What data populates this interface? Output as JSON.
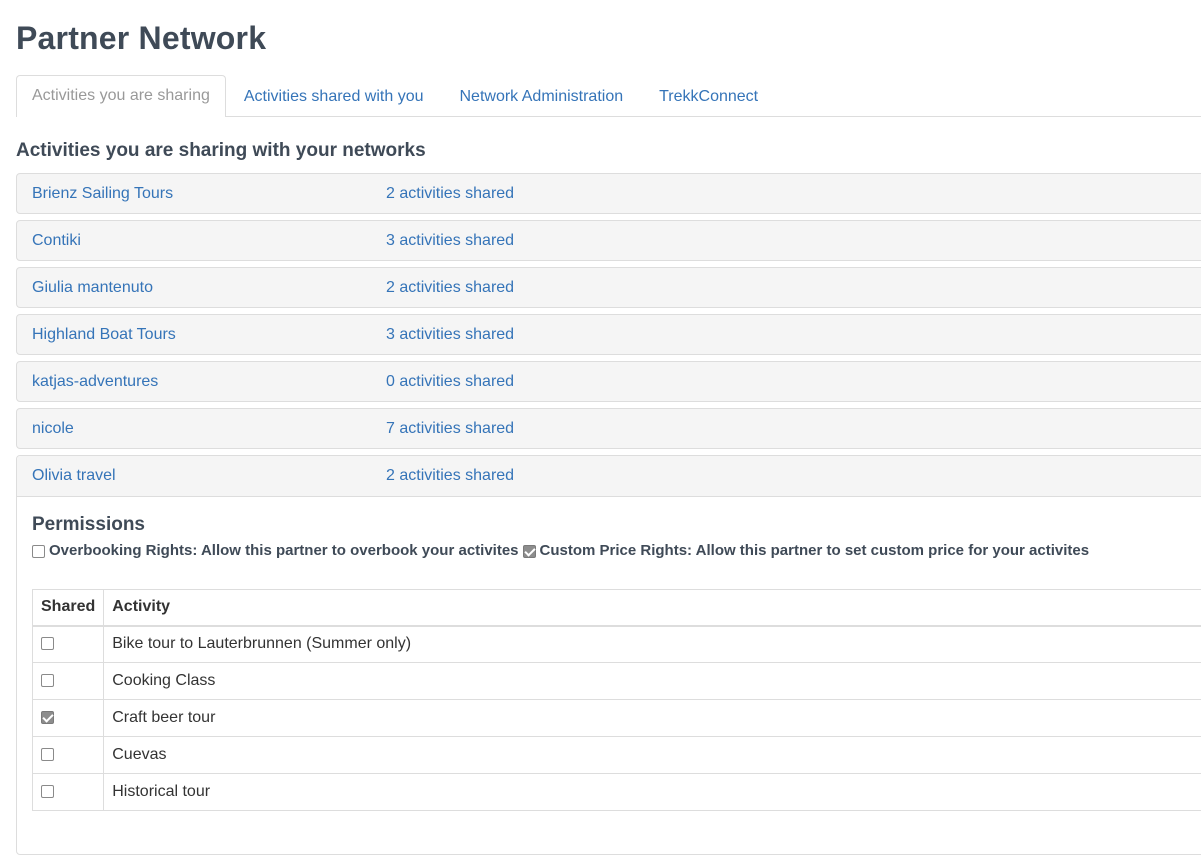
{
  "page": {
    "title": "Partner Network"
  },
  "tabs": [
    {
      "label": "Activities you are sharing",
      "active": true
    },
    {
      "label": "Activities shared with you",
      "active": false
    },
    {
      "label": "Network Administration",
      "active": false
    },
    {
      "label": "TrekkConnect",
      "active": false
    }
  ],
  "section": {
    "heading": "Activities you are sharing with your networks"
  },
  "networks": [
    {
      "name": "Brienz Sailing Tours",
      "count": "2 activities shared"
    },
    {
      "name": "Contiki",
      "count": "3 activities shared"
    },
    {
      "name": "Giulia mantenuto",
      "count": "2 activities shared"
    },
    {
      "name": "Highland Boat Tours",
      "count": "3 activities shared"
    },
    {
      "name": "katjas-adventures",
      "count": "0 activities shared"
    },
    {
      "name": "nicole",
      "count": "7 activities shared"
    },
    {
      "name": "Olivia travel",
      "count": "2 activities shared",
      "expanded": true
    }
  ],
  "permissions": {
    "title": "Permissions",
    "overbooking": {
      "label": "Overbooking Rights: Allow this partner to overbook your activites",
      "checked": false
    },
    "custom_price": {
      "label": "Custom Price Rights: Allow this partner to set custom price for your activites",
      "checked": true
    }
  },
  "activity_table": {
    "headers": {
      "shared": "Shared",
      "activity": "Activity"
    },
    "rows": [
      {
        "name": "Bike tour to Lauterbrunnen (Summer only)",
        "shared": false
      },
      {
        "name": "Cooking Class",
        "shared": false
      },
      {
        "name": "Craft beer tour",
        "shared": true
      },
      {
        "name": "Cuevas",
        "shared": false
      },
      {
        "name": "Historical tour",
        "shared": false
      }
    ]
  },
  "colors": {
    "link": "#3574b8",
    "heading": "#3f4a57",
    "row_bg": "#f5f5f5",
    "border": "#dddddd",
    "checked": "#8d8d8d"
  }
}
